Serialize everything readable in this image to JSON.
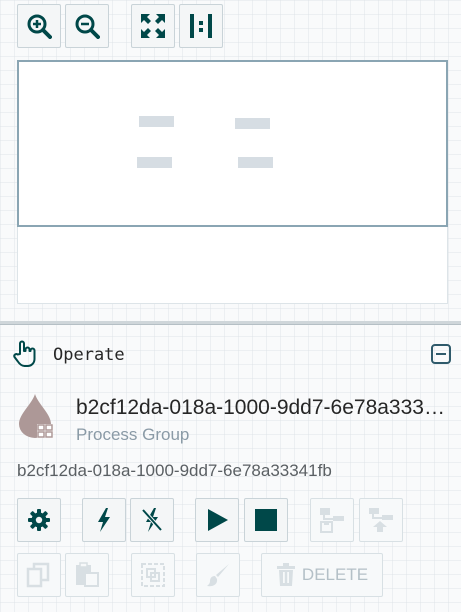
{
  "toolbar": {
    "zoom_in": "zoom-in-icon",
    "zoom_out": "zoom-out-icon",
    "fit": "fit-icon",
    "actual_size": "actual-size-icon"
  },
  "operate": {
    "title": "Operate",
    "component": {
      "name": "b2cf12da-018a-1000-9dd7-6e78a33341fb",
      "type": "Process Group",
      "id": "b2cf12da-018a-1000-9dd7-6e78a33341fb"
    },
    "buttons": {
      "delete_label": "DELETE"
    }
  },
  "colors": {
    "icon_dark": "#004849",
    "icon_disabled": "#9fb0b9",
    "group_icon": "#ad9897"
  }
}
